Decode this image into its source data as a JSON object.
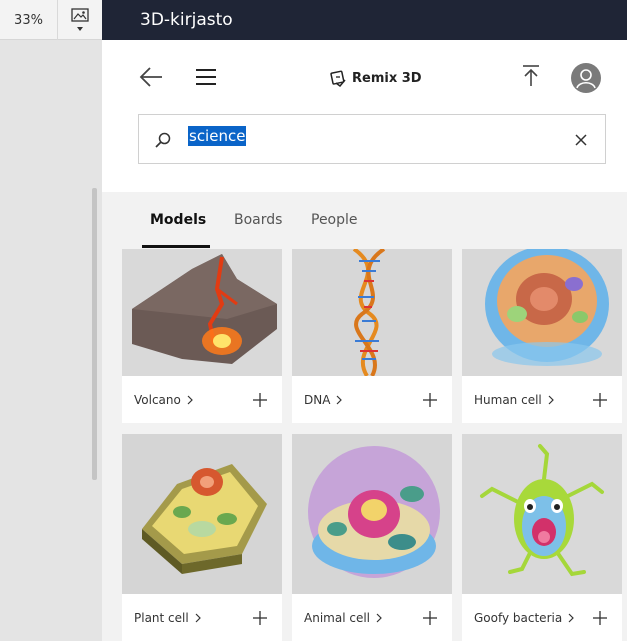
{
  "host": {
    "zoom_label": "33%",
    "image_button_icon": "image-icon"
  },
  "app": {
    "title": "3D-kirjasto",
    "brand": "Remix 3D",
    "brand_icon": "remix3d-logo-icon"
  },
  "search": {
    "value": "science",
    "placeholder": ""
  },
  "tabs": [
    {
      "label": "Models",
      "active": true
    },
    {
      "label": "Boards",
      "active": false
    },
    {
      "label": "People",
      "active": false
    }
  ],
  "models": [
    {
      "name": "Volcano"
    },
    {
      "name": "DNA"
    },
    {
      "name": "Human cell"
    },
    {
      "name": "Plant cell"
    },
    {
      "name": "Animal cell"
    },
    {
      "name": "Goofy bacteria"
    }
  ],
  "colors": {
    "titlebar": "#1f2536",
    "selection": "#0a64c8",
    "panel_bg": "#f2f2f2"
  }
}
